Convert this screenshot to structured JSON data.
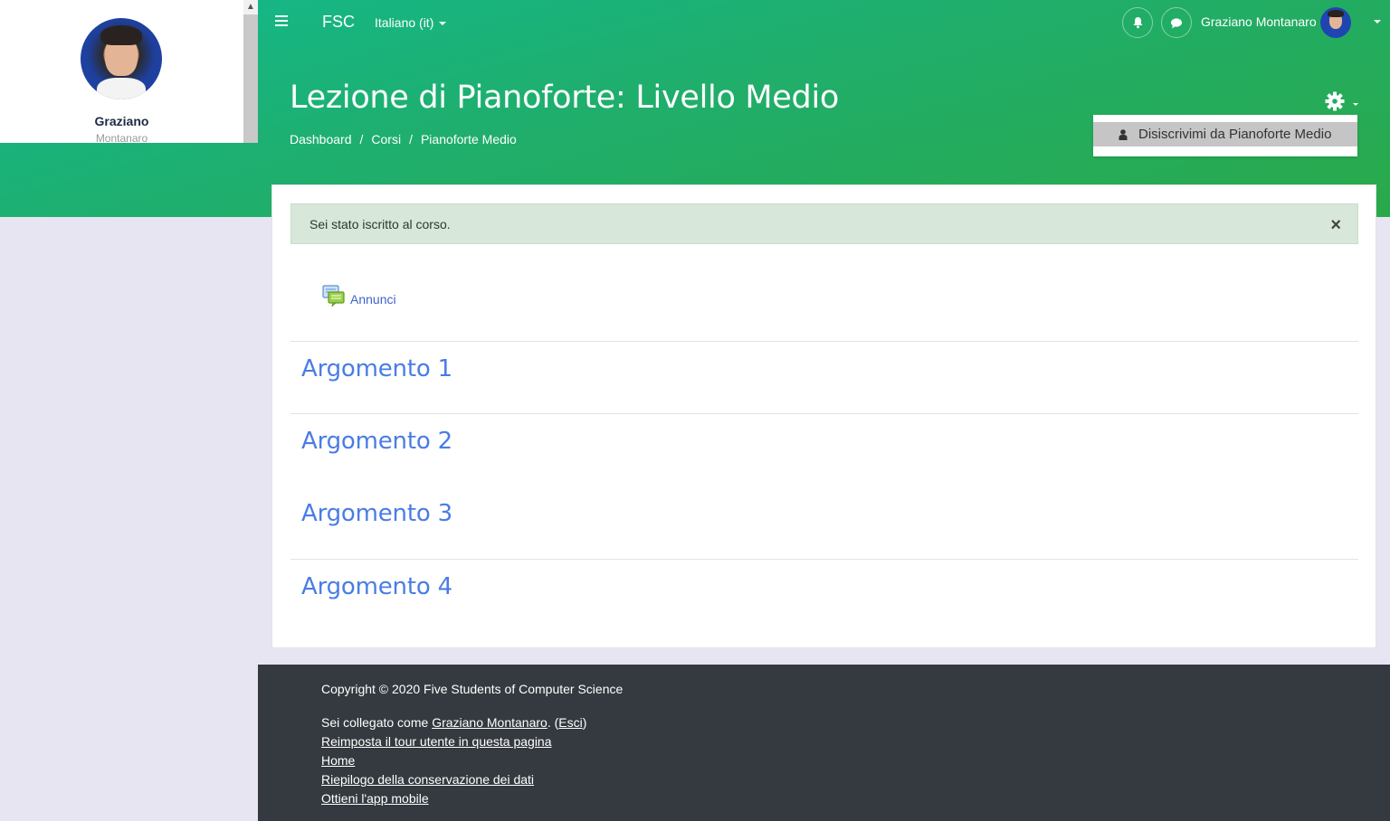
{
  "navbar": {
    "brand": "FSC",
    "language": "Italiano (it)",
    "user_name": "Graziano Montanaro"
  },
  "sidebar": {
    "first_name": "Graziano",
    "last_name": "Montanaro"
  },
  "header": {
    "title": "Lezione di Pianoforte: Livello Medio",
    "breadcrumb": [
      "Dashboard",
      "Corsi",
      "Pianoforte Medio"
    ],
    "breadcrumb_sep": "/"
  },
  "settings_menu": {
    "unenrol_label": "Disiscrivimi da Pianoforte Medio"
  },
  "alert": {
    "message": "Sei stato iscritto al corso.",
    "close": "×"
  },
  "course": {
    "announcements": "Annunci",
    "topics": [
      "Argomento 1",
      "Argomento 2",
      "Argomento 3",
      "Argomento 4"
    ]
  },
  "footer": {
    "copyright": "Copyright © 2020 Five Students of Computer Science",
    "logged_in_prefix": "Sei collegato come ",
    "logged_in_user": "Graziano Montanaro",
    "logout_open": ". (",
    "logout": "Esci",
    "logout_close": ")",
    "reset_tour": "Reimposta il tour utente in questa pagina",
    "home": "Home",
    "data_retention": "Riepilogo della conservazione dei dati",
    "mobile_app": "Ottieni l'app mobile"
  },
  "colors": {
    "accent": "#4a7ce6",
    "banner_start": "#13b98e",
    "banner_end": "#2aa94a",
    "footer_bg": "#343a40",
    "alert_bg": "#d7e7d9"
  }
}
